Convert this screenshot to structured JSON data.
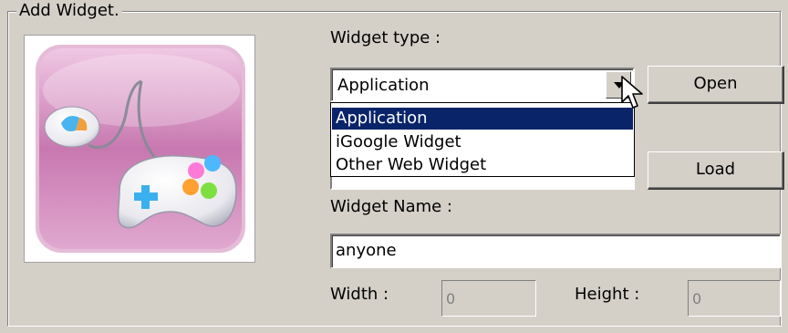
{
  "group": {
    "legend": "Add Widget."
  },
  "widget_type": {
    "label": "Widget type :",
    "selected": "Application",
    "options": [
      "Application",
      "iGoogle Widget",
      "Other Web Widget"
    ]
  },
  "buttons": {
    "open": "Open",
    "load": "Load"
  },
  "widget_name": {
    "label": "Widget Name :",
    "value": "anyone"
  },
  "size": {
    "width_label": "Width :",
    "width_value": "0",
    "height_label": "Height :",
    "height_value": "0"
  },
  "icons": {
    "preview": "gamepad-icon",
    "dropdown": "chevron-down-icon",
    "cursor": "mouse-pointer-icon"
  },
  "colors": {
    "window_bg": "#d4d0c8",
    "selection": "#0a246a",
    "icon_bg": "#d9a0c8"
  }
}
